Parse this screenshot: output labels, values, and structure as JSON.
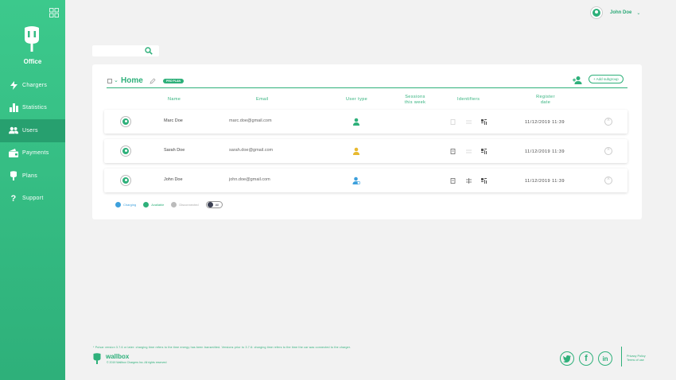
{
  "sidebar": {
    "org_name": "Office",
    "items": [
      {
        "label": "Chargers",
        "icon": "lightning-icon"
      },
      {
        "label": "Statistics",
        "icon": "bar-chart-icon"
      },
      {
        "label": "Users",
        "icon": "users-icon",
        "active": true
      },
      {
        "label": "Payments",
        "icon": "wallet-icon"
      },
      {
        "label": "Plans",
        "icon": "plug-icon"
      },
      {
        "label": "Support",
        "icon": "question-icon"
      }
    ]
  },
  "header": {
    "user_name": "John Doe"
  },
  "search": {
    "value": "",
    "placeholder": ""
  },
  "group": {
    "title": "Home",
    "plan_badge": "PRO PLAN",
    "add_subgroup": "+ Add subgroup"
  },
  "table": {
    "columns": {
      "name": "Name",
      "email": "Email",
      "user_type": "User type",
      "sessions": "Sessions this week",
      "identifiers": "Identifiers",
      "register_date": "Register date"
    },
    "rows": [
      {
        "name": "Marc Doe",
        "email": "marc.doe@gmail.com",
        "user_type": "user",
        "date": "11/12/2019 11:39"
      },
      {
        "name": "Sarah Doe",
        "email": "sarah.doe@gmail.com",
        "user_type": "admin",
        "date": "11/12/2019 11:39"
      },
      {
        "name": "John Doe",
        "email": "john.doe@gmail.com",
        "user_type": "super-admin",
        "date": "11/12/2019 11:39"
      }
    ]
  },
  "legend": {
    "charging": "Charging",
    "available": "Available",
    "disconnected": "Disconnected",
    "all": "All"
  },
  "footer": {
    "note": "* Pulsar version 3.7.6 or later: charging time refers to the time energy has been transmitted. Versions prior to 3.7.6: charging time refers to the time the car was connected to the charger.",
    "brand": "wallbox",
    "copyright": "© 2019 Wallbox Chargers Inc. All rights reserved",
    "privacy": "Privacy Policy",
    "terms": "Terms of use"
  },
  "colors": {
    "accent": "#2eb07a",
    "charging": "#3da0dc",
    "available": "#2eb07a",
    "disconnected": "#bbbbbb",
    "all": "#3a3f52"
  }
}
